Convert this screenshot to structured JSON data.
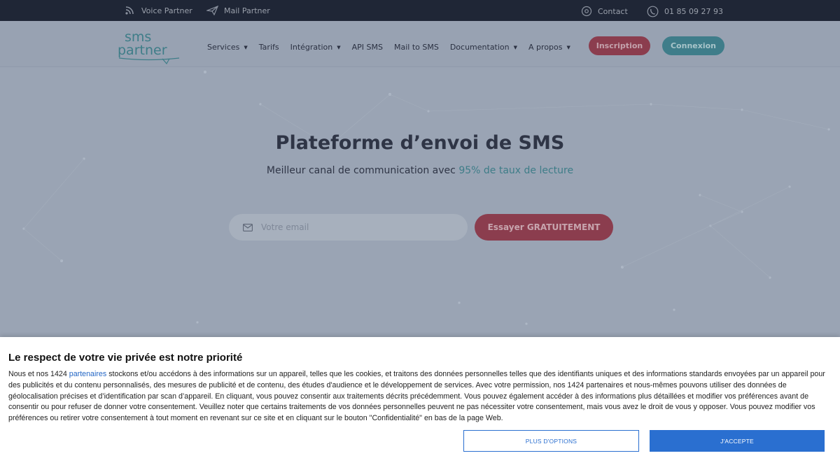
{
  "topbar": {
    "voice_partner": "Voice Partner",
    "mail_partner": "Mail Partner",
    "contact": "Contact",
    "phone": "01 85 09 27 93"
  },
  "header": {
    "logo_line1": "sms",
    "logo_line2": "partner",
    "nav": [
      {
        "label": "Services",
        "caret": "▼"
      },
      {
        "label": "Tarifs"
      },
      {
        "label": "Intégration",
        "caret": "▼"
      },
      {
        "label": "API SMS"
      },
      {
        "label": "Mail to SMS"
      },
      {
        "label": "Documentation",
        "caret": "▼"
      },
      {
        "label": "A propos",
        "caret": "▼"
      }
    ],
    "signup_label": "Inscription",
    "login_label": "Connexion"
  },
  "hero": {
    "title": "Plateforme d’envoi de SMS",
    "subtitle_prefix": "Meilleur canal de communication avec ",
    "subtitle_accent": "95% de taux de lecture",
    "email_placeholder": "Votre email",
    "try_label": "Essayer GRATUITEMENT"
  },
  "consent": {
    "title": "Le respect de votre vie privée est notre priorité",
    "text_prefix": "Nous et nos 1424 ",
    "text_link": "partenaires",
    "text_body": " stockons et/ou accédons à des informations sur un appareil, telles que les cookies, et traitons des données personnelles telles que des identifiants uniques et des informations standards envoyées par un appareil pour des publicités et du contenu personnalisés, des mesures de publicité et de contenu, des études d'audience et le développement de services. Avec votre permission, nos 1424 partenaires et nous-mêmes pouvons utiliser des données de géolocalisation précises et d’identification par scan d’appareil. En cliquant, vous pouvez consentir aux traitements décrits précédemment. Vous pouvez également accéder à des informations plus détaillées et modifier vos préférences avant de consentir ou pour refuser de donner votre consentement. Veuillez noter que certains traitements de vos données personnelles peuvent ne pas nécessiter votre consentement, mais vous avez le droit de vous y opposer. Vous pouvez modifier vos préférences ou retirer votre consentement à tout moment en revenant sur ce site et en cliquant sur le bouton \"Confidentialité\" en bas de la page Web.",
    "more_options_label": "PLUS D'OPTIONS",
    "accept_label": "J'ACCEPTE"
  },
  "colors": {
    "topbar_bg": "#1f2636",
    "overlay_bg": "#9aa4b4",
    "accent_teal": "#3e7d88",
    "accent_red": "#8b3d4e",
    "consent_blue": "#2a6fd0"
  }
}
